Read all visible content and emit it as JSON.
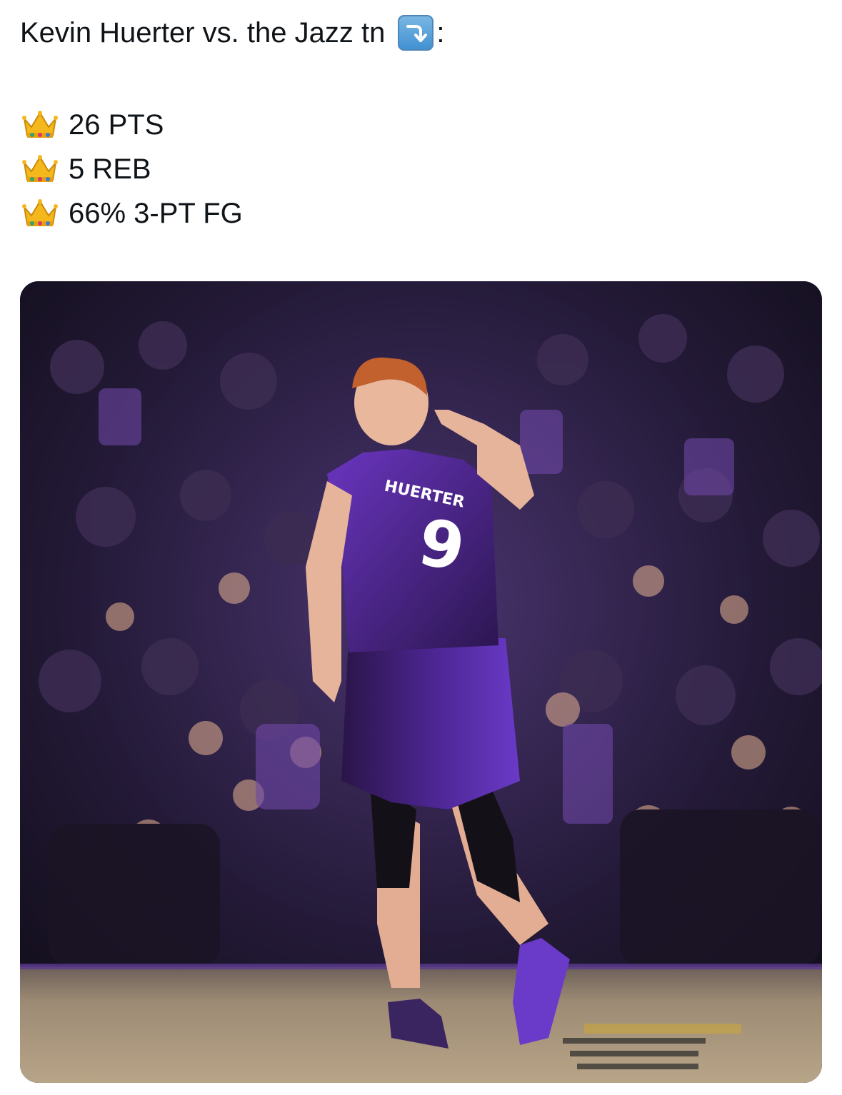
{
  "tweet": {
    "headline": "Kevin Huerter vs. the Jazz tn",
    "headline_suffix": ":",
    "headline_icon": "down-right-arrow-icon",
    "stats": [
      {
        "icon": "crown-icon",
        "label": "26 PTS"
      },
      {
        "icon": "crown-icon",
        "label": "5 REB"
      },
      {
        "icon": "crown-icon",
        "label": "66% 3-PT FG"
      }
    ]
  },
  "photo": {
    "jersey_name": "HUERTER",
    "jersey_number": "9",
    "jersey_color": "#5a2aa0",
    "crowd_color": "#2a1f3d",
    "floor_color": "#a08c70"
  }
}
